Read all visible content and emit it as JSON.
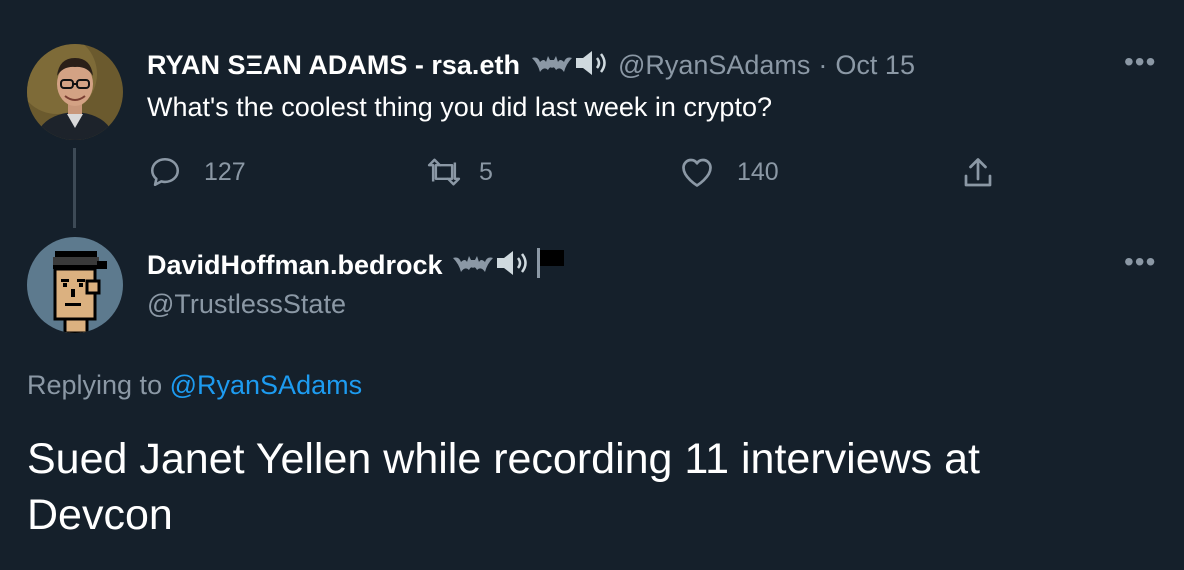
{
  "tweet1": {
    "name": "RYAN SΞAN ADAMS - rsa.eth",
    "handle": "@RyanSAdams",
    "separator": "·",
    "date": "Oct 15",
    "text": "What's the coolest thing you did last week in crypto?",
    "stats": {
      "replies": "127",
      "retweets": "5",
      "likes": "140"
    }
  },
  "tweet2": {
    "name": "DavidHoffman.bedrock",
    "handle": "@TrustlessState",
    "replying_prefix": "Replying to",
    "replying_to": "@RyanSAdams",
    "text": "Sued Janet Yellen while recording 11 interviews at Devcon"
  },
  "more_label": "•••",
  "colors": {
    "background": "#15202b",
    "muted": "#8b98a5",
    "link": "#1d9bf0",
    "thread_line": "#3d4a56"
  },
  "icons": [
    "bat-icon",
    "speaker-icon",
    "flag-icon",
    "reply-icon",
    "retweet-icon",
    "like-icon",
    "share-icon",
    "more-icon"
  ]
}
